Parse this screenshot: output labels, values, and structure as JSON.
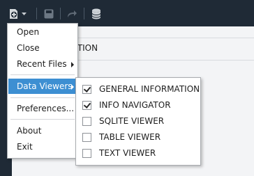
{
  "toolbar": {
    "icons": [
      "add-file-icon",
      "chevron-down-icon",
      "save-icon",
      "share-icon",
      "database-icon"
    ]
  },
  "panel": {
    "title_fragment": "IATION"
  },
  "file_menu": {
    "items": [
      {
        "label": "Open"
      },
      {
        "label": "Close"
      },
      {
        "label": "Recent Files",
        "has_submenu": true
      },
      {
        "label": "Data Viewers",
        "has_submenu": true,
        "highlighted": true
      },
      {
        "label": "Preferences..."
      },
      {
        "label": "About"
      },
      {
        "label": "Exit"
      }
    ]
  },
  "data_viewers_submenu": {
    "items": [
      {
        "label": "GENERAL INFORMATION",
        "checked": true
      },
      {
        "label": "INFO NAVIGATOR",
        "checked": true
      },
      {
        "label": "SQLITE VIEWER",
        "checked": false
      },
      {
        "label": "TABLE VIEWER",
        "checked": false
      },
      {
        "label": "TEXT VIEWER",
        "checked": false
      }
    ]
  },
  "colors": {
    "toolbar_bg": "#1f2a36",
    "highlight": "#3d8fd2"
  }
}
